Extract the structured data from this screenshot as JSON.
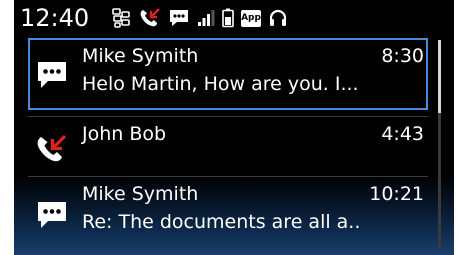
{
  "status_bar": {
    "time": "12:40",
    "icons": [
      "bbm-icon",
      "missed-call-icon",
      "message-icon",
      "signal-bars-icon",
      "battery-icon",
      "app-notification-icon",
      "headset-icon"
    ],
    "app_badge_label": "App"
  },
  "list": {
    "items": [
      {
        "type": "message",
        "icon": "message-icon",
        "sender": "Mike Symith",
        "time": "8:30",
        "preview": "Helo Martin, How are you. I...",
        "selected": true
      },
      {
        "type": "missed-call",
        "icon": "missed-call-icon",
        "sender": "John Bob",
        "time": "4:43"
      },
      {
        "type": "message",
        "icon": "message-icon",
        "sender": "Mike Symith",
        "time": "10:21",
        "preview": "Re: The documents are all a.."
      }
    ]
  },
  "colors": {
    "background": "#000000",
    "selection": "#4a8be0",
    "missed_call_arrow": "#e0201c",
    "text": "#ffffff"
  },
  "scroll": {
    "visible_fraction": 0.35,
    "position_fraction": 0.0
  }
}
